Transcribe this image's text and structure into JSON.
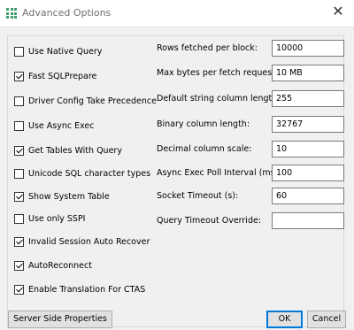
{
  "window": {
    "title": "Advanced Options",
    "close_glyph": "✕"
  },
  "checkboxes": [
    {
      "label": "Use Native Query",
      "checked": false
    },
    {
      "label": "Fast SQLPrepare",
      "checked": true
    },
    {
      "label": "Driver Config Take Precedence",
      "checked": false
    },
    {
      "label": "Use Async Exec",
      "checked": false
    },
    {
      "label": "Get Tables With Query",
      "checked": true
    },
    {
      "label": "Unicode SQL character types",
      "checked": false
    },
    {
      "label": "Show System Table",
      "checked": true
    },
    {
      "label": "Use only SSPI",
      "checked": false
    },
    {
      "label": "Invalid Session Auto Recover",
      "checked": true
    },
    {
      "label": "AutoReconnect",
      "checked": true
    },
    {
      "label": "Enable Translation For CTAS",
      "checked": true
    }
  ],
  "fields": [
    {
      "label": "Rows fetched per block:",
      "value": "10000"
    },
    {
      "label": "Max bytes per fetch request:",
      "value": "10 MB"
    },
    {
      "label": "Default string column length:",
      "value": "255"
    },
    {
      "label": "Binary column length:",
      "value": "32767"
    },
    {
      "label": "Decimal column scale:",
      "value": "10"
    },
    {
      "label": "Async Exec Poll Interval (ms):",
      "value": "100"
    },
    {
      "label": "Socket Timeout (s):",
      "value": "60"
    },
    {
      "label": "Query Timeout Override:",
      "value": ""
    }
  ],
  "buttons": {
    "server_side": "Server Side Properties",
    "ok": "OK",
    "cancel": "Cancel"
  }
}
